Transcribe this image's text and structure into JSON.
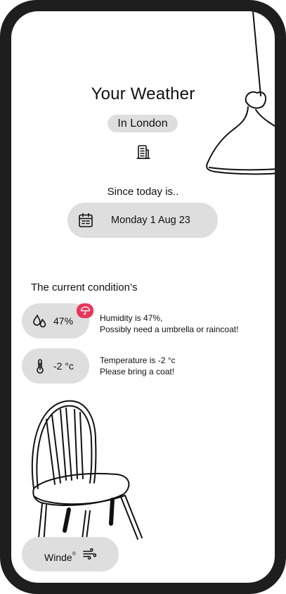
{
  "header": {
    "title": "Your Weather",
    "location": "In London"
  },
  "date_section": {
    "label": "Since today is..",
    "date": "Monday 1 Aug 23"
  },
  "conditions": {
    "title": "The current condition’s",
    "humidity": {
      "value": "47%",
      "note_line1": "Humidity is 47%,",
      "note_line2": "Possibly need a umbrella or raincoat!"
    },
    "temperature": {
      "value": "-2 °c",
      "note_line1": "Temperature is -2 °c",
      "note_line2": "Please bring a coat!"
    }
  },
  "wind": {
    "label": "Winde",
    "mark": "®"
  },
  "colors": {
    "frame": "#1e1e1e",
    "pill": "#dedede",
    "badge": "#e8365a"
  },
  "icons": [
    "building-icon",
    "calendar-icon",
    "droplets-icon",
    "umbrella-icon",
    "thermometer-icon",
    "wind-icon"
  ]
}
